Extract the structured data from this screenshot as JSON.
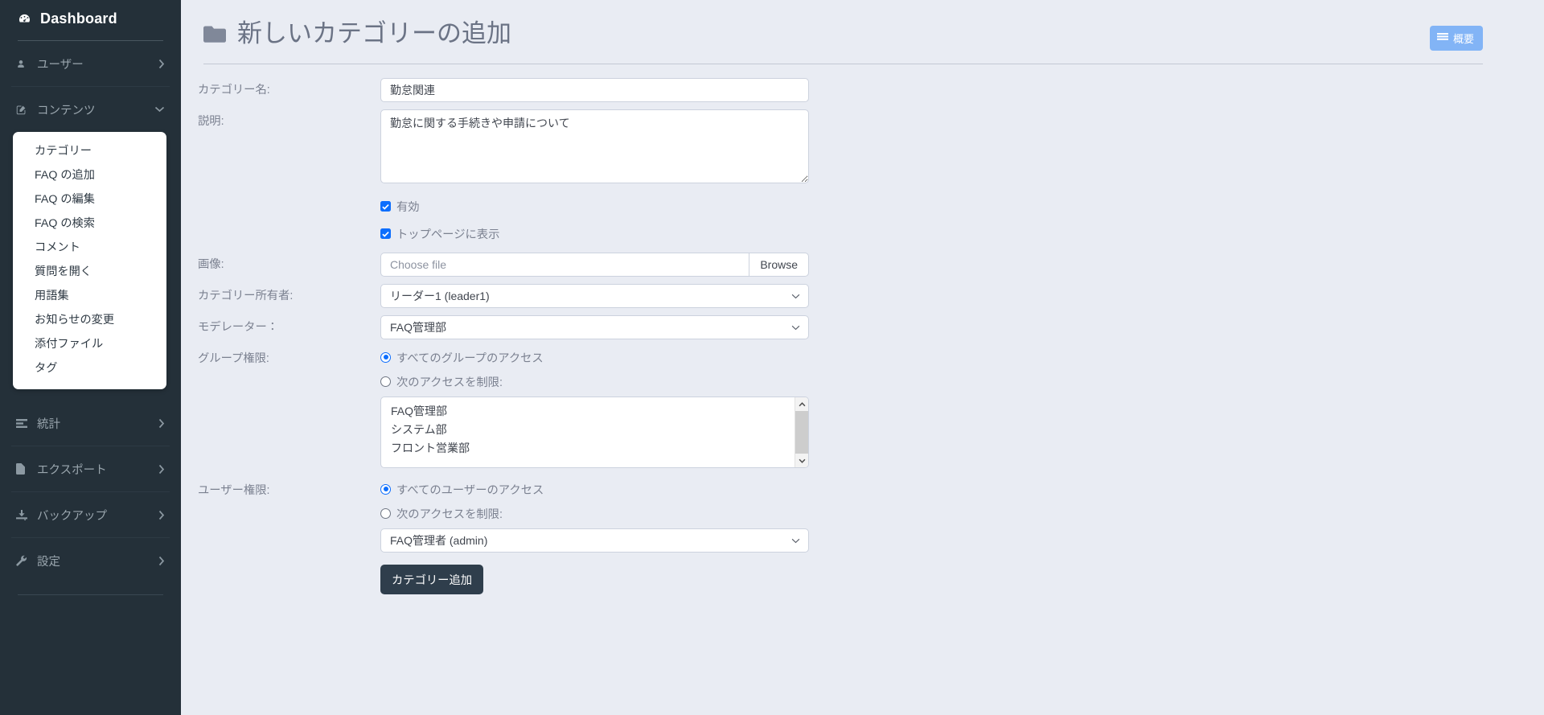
{
  "sidebar": {
    "brand": "Dashboard",
    "brand_icon": "dashboard-gauge-icon",
    "items": [
      {
        "label": "ユーザー",
        "icon": "user-icon",
        "chevron": "chevron-right-icon",
        "expanded": false
      },
      {
        "label": "コンテンツ",
        "icon": "edit-square-icon",
        "chevron": "chevron-down-icon",
        "expanded": true
      },
      {
        "label": "統計",
        "icon": "bars-icon",
        "chevron": "chevron-right-icon",
        "expanded": false
      },
      {
        "label": "エクスポート",
        "icon": "file-icon",
        "chevron": "chevron-right-icon",
        "expanded": false
      },
      {
        "label": "バックアップ",
        "icon": "download-icon",
        "chevron": "chevron-right-icon",
        "expanded": false
      },
      {
        "label": "設定",
        "icon": "wrench-icon",
        "chevron": "chevron-right-icon",
        "expanded": false
      }
    ],
    "submenu": [
      "カテゴリー",
      "FAQ の追加",
      "FAQ の編集",
      "FAQ の検索",
      "コメント",
      "質問を開く",
      "用語集",
      "お知らせの変更",
      "添付ファイル",
      "タグ"
    ]
  },
  "header": {
    "title": "新しいカテゴリーの追加",
    "title_icon": "folder-icon",
    "overview_button": "概要",
    "overview_icon": "list-icon",
    "accent_color": "#82b4f6"
  },
  "form": {
    "category_name": {
      "label": "カテゴリー名:",
      "value": "勤怠関連"
    },
    "description": {
      "label": "説明:",
      "value": "勤怠に関する手続きや申請について"
    },
    "active_checkbox": {
      "label": "有効",
      "checked": true
    },
    "show_on_top_checkbox": {
      "label": "トップページに表示",
      "checked": true
    },
    "image": {
      "label": "画像:",
      "placeholder": "Choose file",
      "browse_label": "Browse"
    },
    "owner": {
      "label": "カテゴリー所有者:",
      "value": "リーダー1 (leader1)",
      "options": [
        "リーダー1 (leader1)"
      ]
    },
    "moderator": {
      "label": "モデレーター：",
      "value": "FAQ管理部",
      "options": [
        "FAQ管理部"
      ]
    },
    "group_permission": {
      "label": "グループ権限:",
      "radio_all": "すべてのグループのアクセス",
      "radio_restrict": "次のアクセスを制限:",
      "selected": "all",
      "list_items": [
        "FAQ管理部",
        "システム部",
        "フロント営業部"
      ]
    },
    "user_permission": {
      "label": "ユーザー権限:",
      "radio_all": "すべてのユーザーのアクセス",
      "radio_restrict": "次のアクセスを制限:",
      "selected": "all",
      "select_value": "FAQ管理者 (admin)",
      "select_options": [
        "FAQ管理者 (admin)"
      ]
    },
    "submit_button": "カテゴリー追加"
  }
}
